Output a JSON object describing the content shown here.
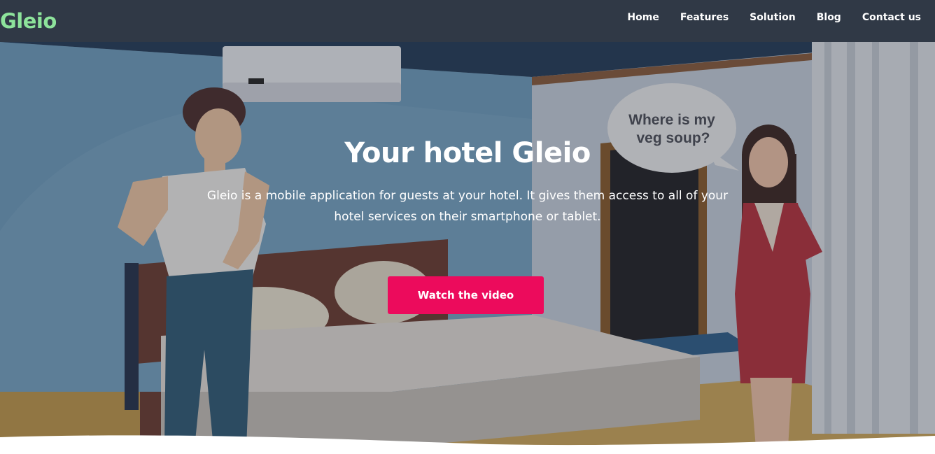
{
  "brand": {
    "logo": "Gleio",
    "logo_color": "#8de39b"
  },
  "nav": {
    "items": [
      {
        "label": "Home"
      },
      {
        "label": "Features"
      },
      {
        "label": "Solution"
      },
      {
        "label": "Blog"
      },
      {
        "label": "Contact us"
      }
    ]
  },
  "hero": {
    "title": "Your hotel Gleio",
    "description": "Gleio is a mobile application for guests at your hotel. It gives them access to all of your hotel services on their smartphone or tablet.",
    "cta_label": "Watch the video",
    "cta_color": "#ec0b5c",
    "speech_bubble_line1": "Where is my",
    "speech_bubble_line2": "veg soup?"
  }
}
